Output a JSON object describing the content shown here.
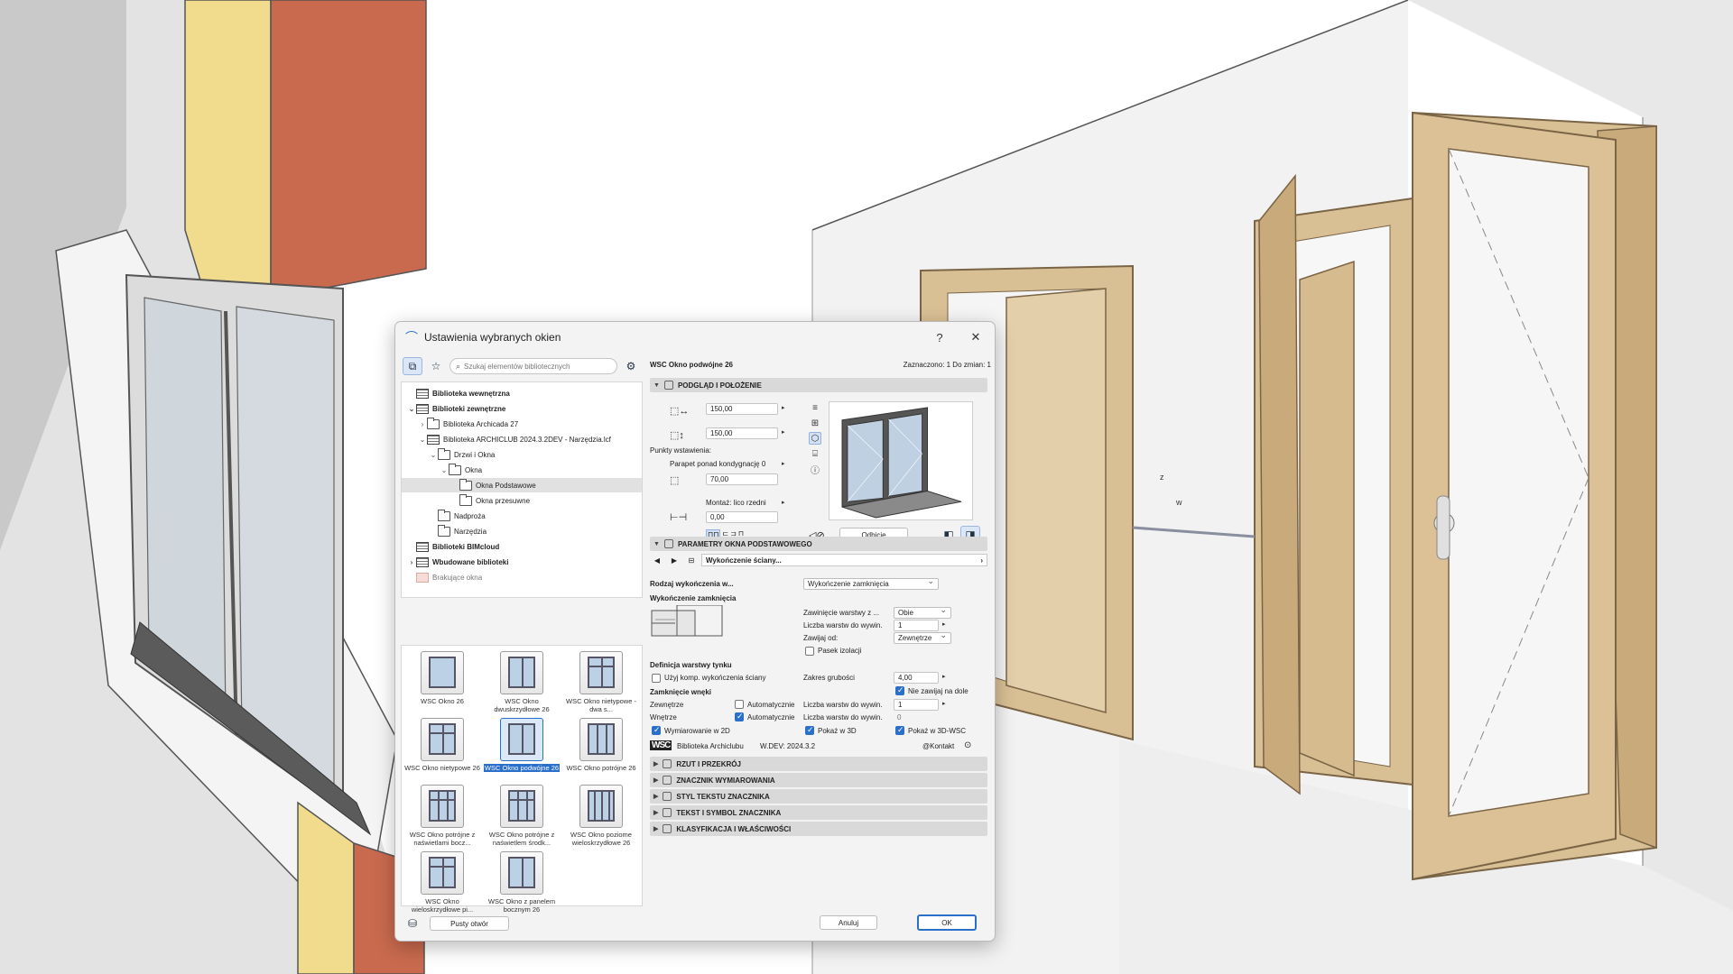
{
  "dialog": {
    "title": "Ustawienia wybranych okien",
    "help_label": "?",
    "close_label": "✕"
  },
  "library": {
    "search_placeholder": "Szukaj elementów bibliotecznych",
    "tree": [
      {
        "label": "Biblioteka wewnętrzna",
        "indent": 0,
        "icon": "lib",
        "twisty": "",
        "bold": true
      },
      {
        "label": "Biblioteki zewnętrzne",
        "indent": 0,
        "icon": "lib",
        "twisty": "⌄",
        "bold": true
      },
      {
        "label": "Biblioteka Archicada 27",
        "indent": 1,
        "icon": "folder",
        "twisty": "›"
      },
      {
        "label": "Biblioteka ARCHICLUB 2024.3.2DEV - Narzędzia.lcf",
        "indent": 1,
        "icon": "lib",
        "twisty": "⌄"
      },
      {
        "label": "Drzwi i Okna",
        "indent": 2,
        "icon": "folder",
        "twisty": "⌄"
      },
      {
        "label": "Okna",
        "indent": 3,
        "icon": "folder",
        "twisty": "⌄"
      },
      {
        "label": "Okna Podstawowe",
        "indent": 4,
        "icon": "folder",
        "twisty": "",
        "selected": true
      },
      {
        "label": "Okna przesuwne",
        "indent": 4,
        "icon": "folder",
        "twisty": ""
      },
      {
        "label": "Nadproża",
        "indent": 2,
        "icon": "folder",
        "twisty": ""
      },
      {
        "label": "Narzędzia",
        "indent": 2,
        "icon": "folder",
        "twisty": ""
      },
      {
        "label": "Biblioteki BIMcloud",
        "indent": 0,
        "icon": "lib",
        "twisty": "",
        "bold": true
      },
      {
        "label": "Wbudowane biblioteki",
        "indent": 0,
        "icon": "lib",
        "twisty": "›",
        "bold": true
      },
      {
        "label": "Brakujące okna",
        "indent": 0,
        "icon": "missing",
        "twisty": "",
        "muted": true
      }
    ],
    "thumbs": [
      {
        "label": "WSC Okno 26",
        "mullions": 0
      },
      {
        "label": "WSC Okno dwuskrzydłowe 26",
        "mullions": 1
      },
      {
        "label": "WSC Okno nietypowe - dwa s...",
        "mullions": 1,
        "transom": true
      },
      {
        "label": "WSC Okno nietypowe 26",
        "mullions": 1,
        "transom": true
      },
      {
        "label": "WSC Okno podwójne 26",
        "mullions": 1,
        "selected": true
      },
      {
        "label": "WSC Okno potrójne 26",
        "mullions": 2
      },
      {
        "label": "WSC Okno potrójne z naświetlami bocz...",
        "mullions": 2,
        "transom": true
      },
      {
        "label": "WSC Okno potrójne z naświetlem środk...",
        "mullions": 2,
        "transom": true
      },
      {
        "label": "WSC Okno poziome wieloskrzydłowe 26",
        "mullions": 3
      },
      {
        "label": "WSC Okno wieloskrzydłowe pi...",
        "mullions": 1,
        "transom": true
      },
      {
        "label": "WSC Okno z panelem bocznym 26",
        "mullions": 1
      }
    ],
    "empty_opening_button": "Pusty otwór"
  },
  "panel": {
    "object_name": "WSC Okno podwójne 26",
    "selection_info": "Zaznaczono: 1 Do zmian: 1",
    "sections": {
      "preview": "PODGLĄD I POŁOŻENIE",
      "params": "PARAMETRY OKNA PODSTAWOWEGO",
      "plan": "RZUT I PRZEKRÓJ",
      "dim_marker": "ZNACZNIK WYMIAROWANIA",
      "marker_text": "STYL TEKSTU ZNACZNIKA",
      "text_symbol": "TEKST I SYMBOL ZNACZNIKA",
      "classification": "KLASYFIKACJA I WŁAŚCIWOŚCI"
    },
    "width": "150,00",
    "height": "150,00",
    "insertion_points_label": "Punkty wstawienia:",
    "sill_label": "Parapet ponad kondygnację 0",
    "sill_value": "70,00",
    "mount_label": "Montaż: lico rzedni",
    "mount_value": "0,00",
    "mirror_button": "Odbicie",
    "finish_combo": "Wykończenie ściany...",
    "finish_type_label": "Rodzaj wykończenia w...",
    "finish_type_value": "Wykończenie zamknięcia",
    "closure_finish_label": "Wykończenie zamknięcia",
    "wrap_layer_label": "Zawinięcie warstwy z ...",
    "wrap_layer_value": "Obie",
    "layer_count_label": "Liczba warstw do wywin.",
    "layer_count_value": "1",
    "wrap_from_label": "Zawijaj od:",
    "wrap_from_value": "Zewnętrze",
    "insulation_strip_label": "Pasek izolacji",
    "plaster_def_label": "Definicja warstwy tynku",
    "use_comp_label": "Użyj komp. wykończenia ściany",
    "thickness_label": "Zakres grubości",
    "thickness_value": "4,00",
    "niche_closure_label": "Zamknięcie wnęki",
    "no_wrap_bottom_label": "Nie zawijaj na dole",
    "exterior_label": "Zewnętrze",
    "interior_label": "Wnętrze",
    "auto_label": "Automatycznie",
    "layer_count2_value": "1",
    "layer_count3_value": "0",
    "dims2d_label": "Wymiarowanie w 2D",
    "show3d_label": "Pokaż w 3D",
    "show3dwsc_label": "Pokaż w 3D-WSC",
    "library_label": "Biblioteka Archiclubu",
    "version_label": "W.DEV: 2024.3.2",
    "contact_label": "@Kontakt",
    "logo_text": "WSC"
  },
  "footer": {
    "cancel": "Anuluj",
    "ok": "OK"
  },
  "scene": {
    "axis_z": "z",
    "axis_w": "w"
  },
  "colors": {
    "accent": "#2a6fc9",
    "brick": "#c96a4e",
    "insulation": "#f1dc8e",
    "wood": "#d9bf94"
  }
}
